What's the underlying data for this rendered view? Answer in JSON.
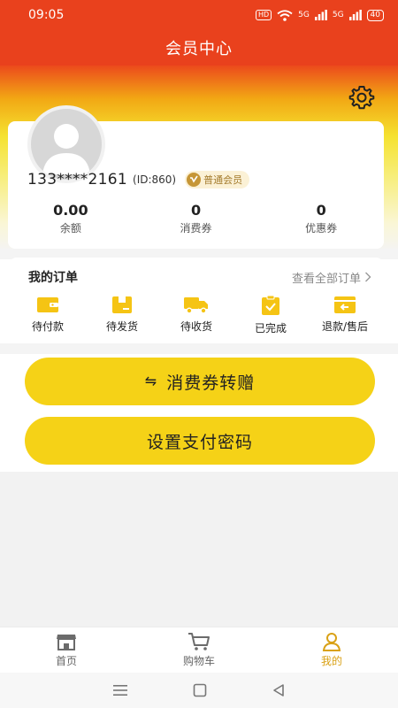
{
  "status_bar": {
    "time": "09:05",
    "hd_label": "HD",
    "signal_1": "5G",
    "signal_2": "5G",
    "battery": "40",
    "icons": [
      "wifi-icon",
      "signal-icon",
      "signal-icon",
      "battery-icon"
    ]
  },
  "header": {
    "title": "会员中心",
    "bg_color": "#e9411d",
    "settings_icon": "gear-icon"
  },
  "profile": {
    "avatar_icon": "default-avatar-icon",
    "phone": "133****2161",
    "user_id": "(ID:860)",
    "member_level": "普通会员",
    "member_icon": "vip-icon"
  },
  "stats": [
    {
      "value": "0.00",
      "label": "余额"
    },
    {
      "value": "0",
      "label": "消费券"
    },
    {
      "value": "0",
      "label": "优惠券"
    }
  ],
  "orders": {
    "title": "我的订单",
    "view_all": "查看全部订单",
    "items": [
      {
        "label": "待付款",
        "icon": "wallet-icon"
      },
      {
        "label": "待发货",
        "icon": "package-icon"
      },
      {
        "label": "待收货",
        "icon": "truck-icon"
      },
      {
        "label": "已完成",
        "icon": "clipboard-check-icon"
      },
      {
        "label": "退款/售后",
        "icon": "refund-icon"
      }
    ]
  },
  "actions": {
    "transfer": {
      "icon_glyph": "⇋",
      "label": "消费券转赠"
    },
    "password": {
      "label": "设置支付密码"
    },
    "button_color": "#f5d217"
  },
  "tabbar": {
    "tabs": [
      {
        "label": "首页",
        "icon": "store-icon",
        "active": false
      },
      {
        "label": "购物车",
        "icon": "cart-icon",
        "active": false
      },
      {
        "label": "我的",
        "icon": "user-icon",
        "active": true
      }
    ],
    "active_color": "#d9a116"
  },
  "system_nav": {
    "icons": [
      "menu-icon",
      "home-square-icon",
      "back-triangle-icon"
    ]
  }
}
